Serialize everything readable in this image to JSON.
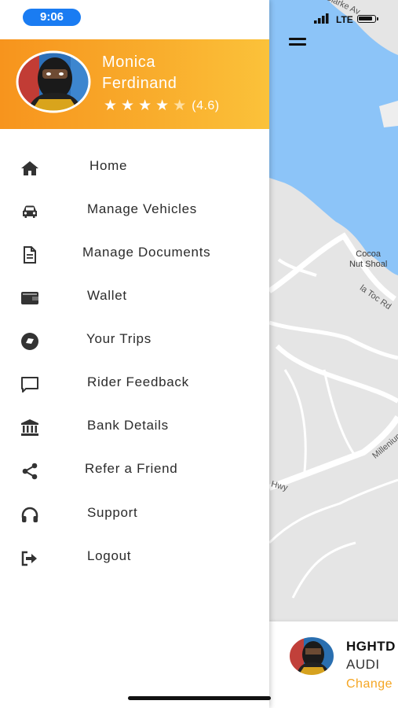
{
  "status_bar": {
    "time": "9:06",
    "network": "LTE"
  },
  "profile": {
    "name": "Monica\nFerdinand",
    "rating": 4.6,
    "rating_text": "(4.6)",
    "stars_filled": 4,
    "stars_total": 5
  },
  "colors": {
    "header_gradient_start": "#f7941d",
    "header_gradient_end": "#fbc23a",
    "time_pill": "#1a7cf2",
    "accent": "#f5a623",
    "water": "#8cc4f8",
    "land": "#e5e5e5"
  },
  "menu": {
    "items": [
      {
        "label": "Home",
        "icon": "home-icon"
      },
      {
        "label": "Manage Vehicles",
        "icon": "car-icon"
      },
      {
        "label": "Manage Documents",
        "icon": "document-icon"
      },
      {
        "label": "Wallet",
        "icon": "wallet-icon"
      },
      {
        "label": "Your Trips",
        "icon": "trips-icon"
      },
      {
        "label": "Rider Feedback",
        "icon": "feedback-icon"
      },
      {
        "label": "Bank Details",
        "icon": "bank-icon"
      },
      {
        "label": "Refer a Friend",
        "icon": "share-icon"
      },
      {
        "label": "Support",
        "icon": "headphones-icon"
      },
      {
        "label": "Logout",
        "icon": "logout-icon"
      }
    ]
  },
  "map": {
    "labels": {
      "clarke": "Clarke Av",
      "cocoa": "Cocoa\nNut Shoal",
      "latoc": "la Toc Rd",
      "millenium": "Millenium",
      "hwy": "Hwy"
    }
  },
  "vehicle": {
    "plate": "HGHTD",
    "model": "AUDI",
    "change_label": "Change"
  }
}
